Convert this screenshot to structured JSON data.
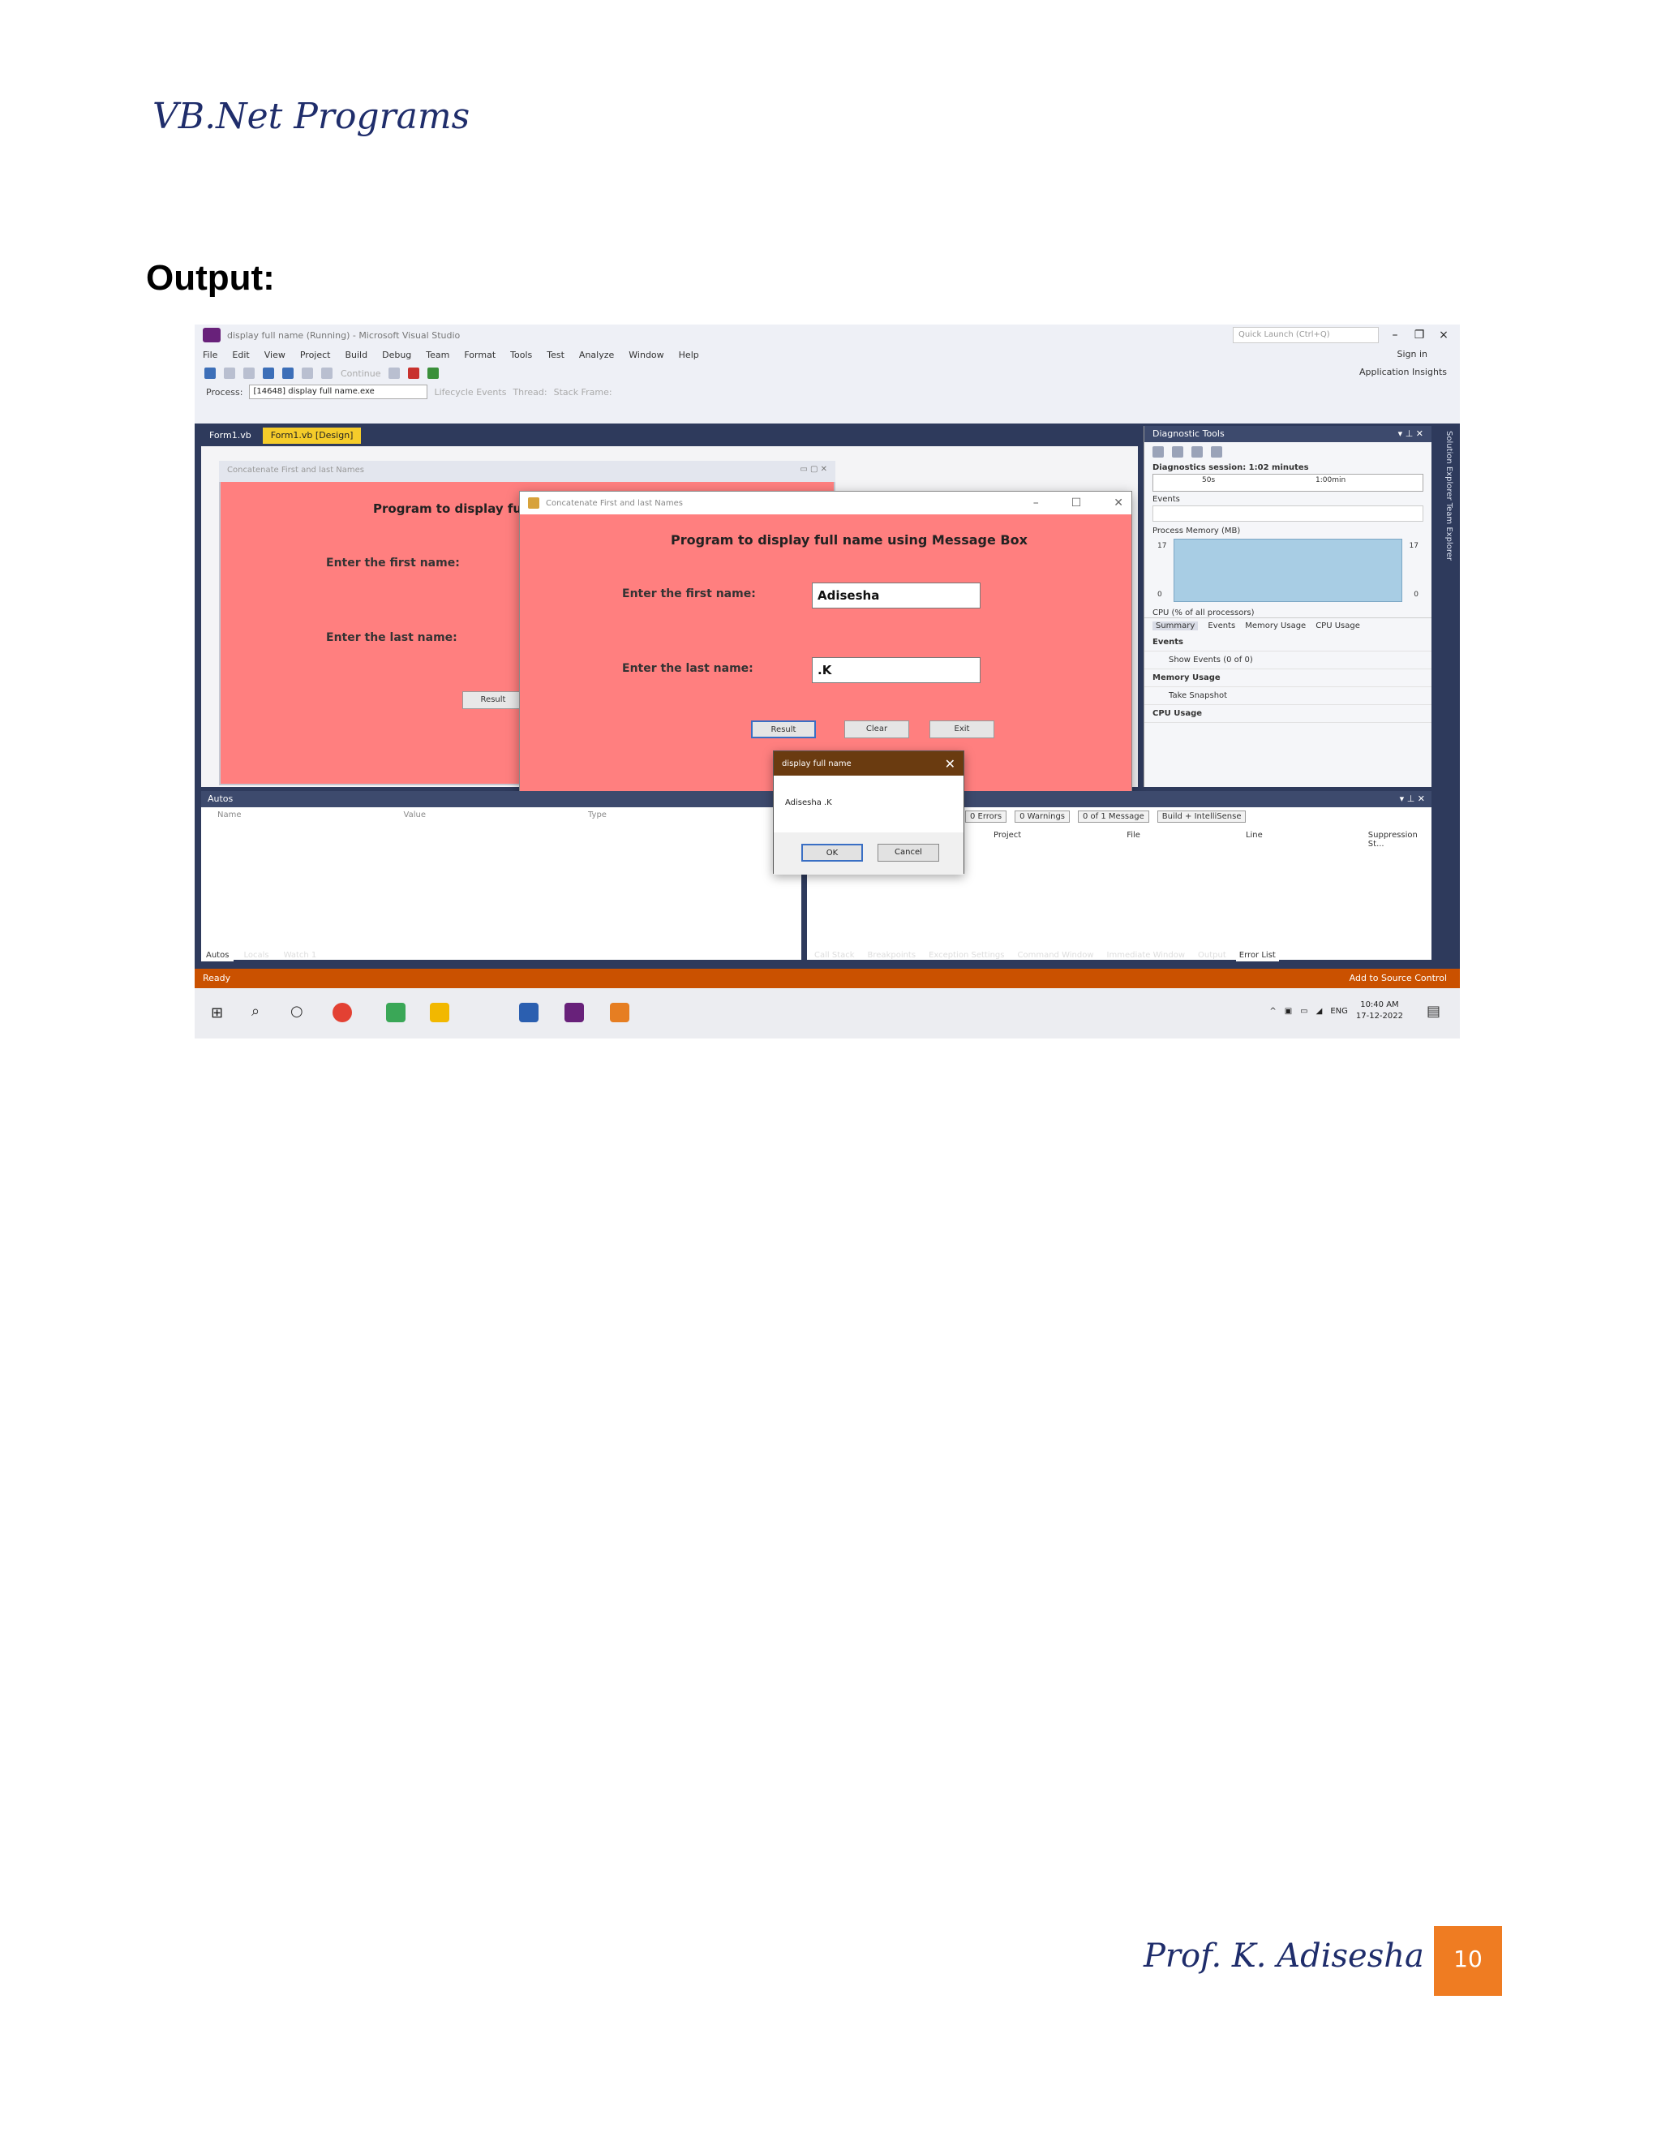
{
  "header": {
    "title": "VB.Net Programs"
  },
  "section": {
    "heading": "Output:"
  },
  "vs": {
    "window_title": "display full name (Running) - Microsoft Visual Studio",
    "quick_launch_placeholder": "Quick Launch (Ctrl+Q)",
    "menu": [
      "File",
      "Edit",
      "View",
      "Project",
      "Build",
      "Debug",
      "Team",
      "Format",
      "Tools",
      "Test",
      "Analyze",
      "Window",
      "Help"
    ],
    "signin": "Sign in",
    "app_insights": "Application Insights",
    "process_label": "Process:",
    "process_value": "[14648] display full name.exe",
    "lifecycle": "Lifecycle Events",
    "thread": "Thread:",
    "stack_frame": "Stack Frame:",
    "continue_label": "Continue",
    "tabs": [
      "Form1.vb",
      "Form1.vb [Design]"
    ]
  },
  "designer": {
    "form_title": "Concatenate First and last Names",
    "heading": "Program to display ful",
    "first_label": "Enter the first name:",
    "last_label": "Enter the last name:",
    "result_button": "Result"
  },
  "running_form": {
    "title": "Concatenate First and last Names",
    "heading": "Program to display full name using Message Box",
    "first_label": "Enter the first name:",
    "first_value": "Adisesha",
    "last_label": "Enter the last name:",
    "last_value": ".K",
    "result_button": "Result",
    "clear_button": "Clear",
    "exit_button": "Exit"
  },
  "message_box": {
    "title": "display full name",
    "text": "Adisesha .K",
    "ok": "OK",
    "cancel": "Cancel"
  },
  "diagnostics": {
    "title": "Diagnostic Tools",
    "session": "Diagnostics session: 1:02 minutes",
    "tick_50s": "50s",
    "tick_1min": "1:00min",
    "events": "Events",
    "process_memory": "Process Memory (MB)",
    "mem_max": "17",
    "mem_min": "0",
    "cpu": "CPU (% of all processors)",
    "tabs": [
      "Summary",
      "Events",
      "Memory Usage",
      "CPU Usage"
    ],
    "events_header": "Events",
    "show_events": "Show Events (0 of 0)",
    "memory_usage": "Memory Usage",
    "take_snapshot": "Take Snapshot",
    "cpu_usage": "CPU Usage"
  },
  "side_strip": "Solution Explorer   Team Explorer",
  "autos": {
    "title": "Autos",
    "columns": [
      "Name",
      "Value",
      "Type"
    ],
    "tabs": [
      "Autos",
      "Locals",
      "Watch 1"
    ]
  },
  "error_list": {
    "errors": "0 Errors",
    "warnings": "0 Warnings",
    "messages": "0 of 1 Message",
    "build_filter": "Build + IntelliSense",
    "columns": [
      "Project",
      "File",
      "Line",
      "Suppression St..."
    ],
    "bottom_tabs": [
      "Call Stack",
      "Breakpoints",
      "Exception Settings",
      "Command Window",
      "Immediate Window",
      "Output",
      "Error List"
    ]
  },
  "status": {
    "ready": "Ready",
    "source_control": "Add to Source Control"
  },
  "taskbar": {
    "lang": "ENG",
    "time": "10:40 AM",
    "date": "17-12-2022"
  },
  "footer": {
    "author": "Prof. K. Adisesha",
    "page": "10"
  }
}
